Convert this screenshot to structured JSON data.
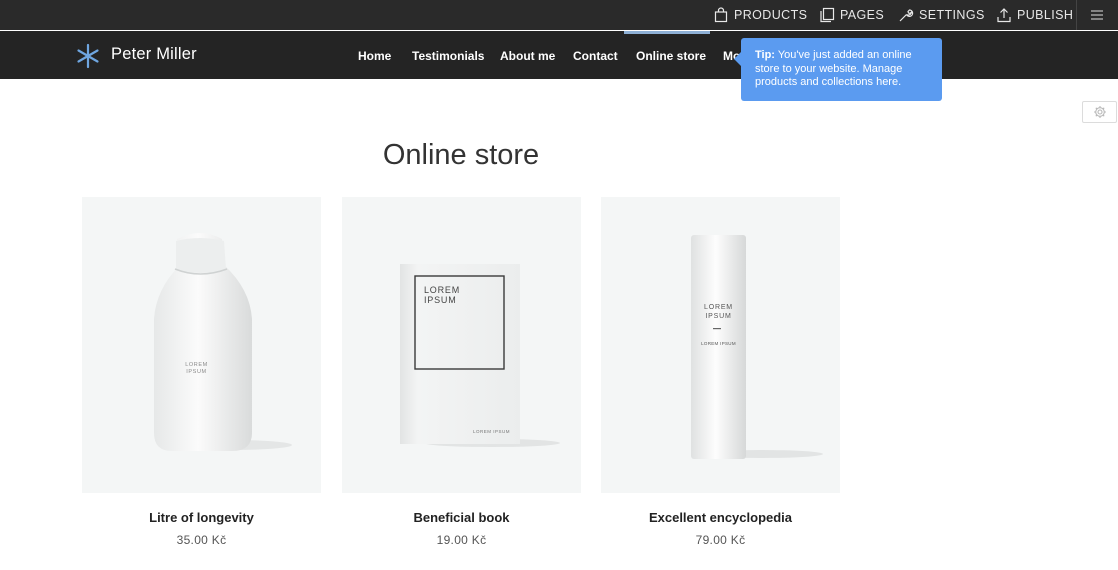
{
  "admin_bar": {
    "products_label": "PRODUCTS",
    "pages_label": "PAGES",
    "settings_label": "SETTINGS",
    "publish_label": "PUBLISH"
  },
  "site": {
    "name": "Peter Miller",
    "nav": [
      "Home",
      "Testimonials",
      "About me",
      "Contact",
      "Online store",
      "More"
    ],
    "active_nav": "Online store"
  },
  "tip": {
    "prefix": "Tip:",
    "text": " You've just added an online store to your website. Manage products and collections here."
  },
  "page": {
    "title": "Online store"
  },
  "products": [
    {
      "name": "Litre of longevity",
      "price": "35.00 Kč",
      "label_line1": "LOREM",
      "label_line2": "IPSUM"
    },
    {
      "name": "Beneficial book",
      "price": "19.00 Kč",
      "label_line1": "LOREM",
      "label_line2": "IPSUM",
      "label_footer": "LOREM IPSUM"
    },
    {
      "name": "Excellent encyclopedia",
      "price": "79.00 Kč",
      "label_line1": "LOREM",
      "label_line2": "IPSUM",
      "label_sub": "LOREM IPSUM"
    }
  ],
  "colors": {
    "admin_bar": "#2a2a2a",
    "site_header": "#242424",
    "tip_bg": "#5b9bf0",
    "active_nav_indicator": "#8fb1d6",
    "logo": "#6fa6e0"
  }
}
